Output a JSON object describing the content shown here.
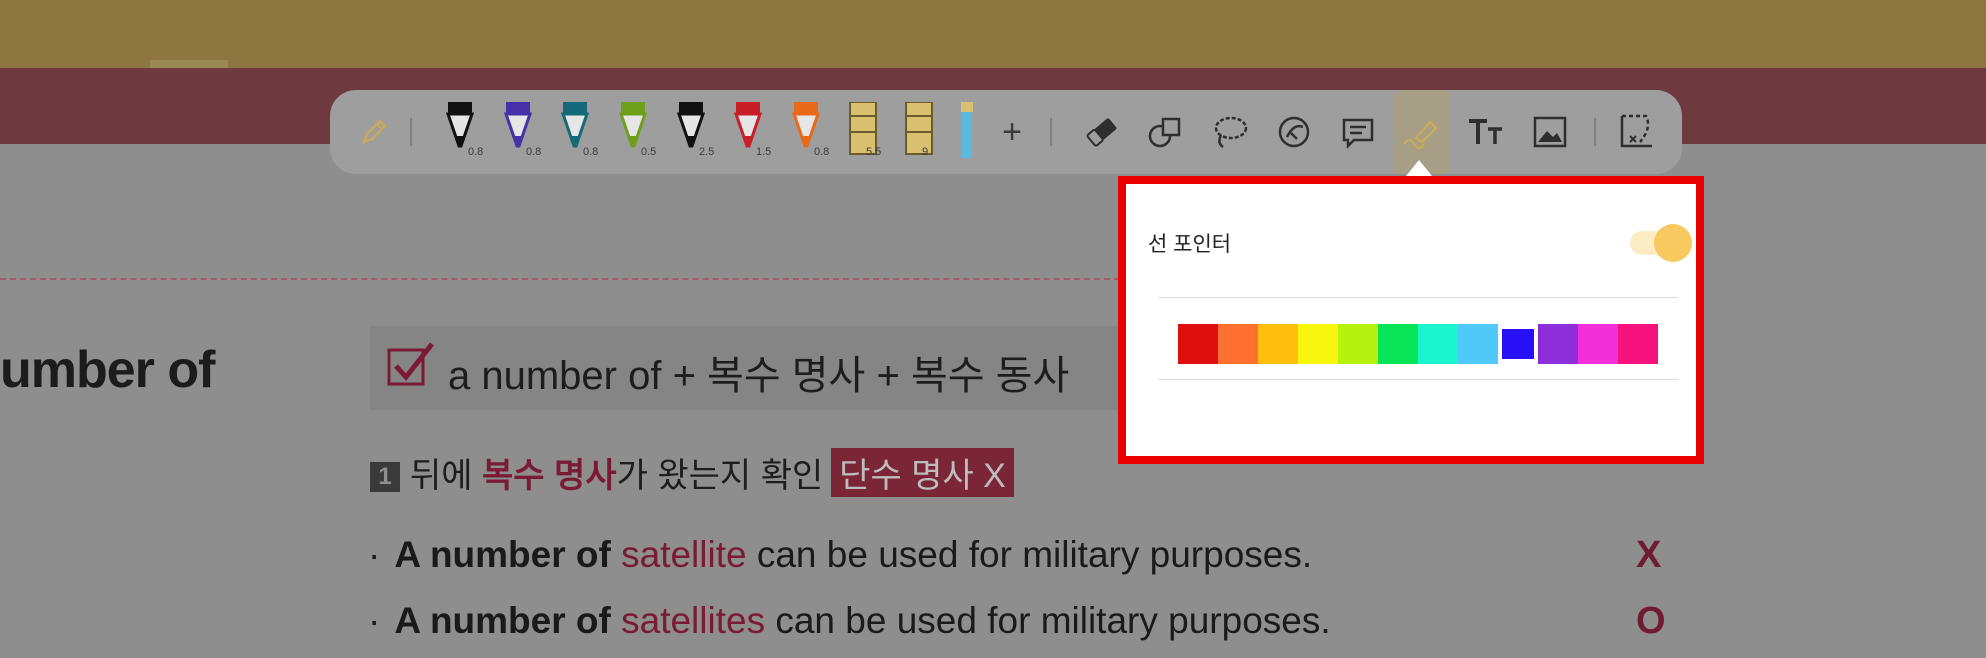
{
  "toolbar": {
    "pens": [
      {
        "color": "#111111",
        "size": "0.8"
      },
      {
        "color": "#4631a8",
        "size": "0.8"
      },
      {
        "color": "#146a78",
        "size": "0.8"
      },
      {
        "color": "#6ea01c",
        "size": "0.5"
      },
      {
        "color": "#111111",
        "size": "2.5"
      },
      {
        "color": "#c81e28",
        "size": "1.5"
      },
      {
        "color": "#e66a1a",
        "size": "0.8"
      }
    ],
    "tapes": [
      {
        "color": "#d9c070",
        "size": "5.5"
      },
      {
        "color": "#d9c070",
        "size": "9"
      }
    ],
    "add_label": "+",
    "tool_icons": [
      "eraser-icon",
      "shapes-icon",
      "lasso-icon",
      "sticker-icon",
      "comment-icon",
      "laser-pointer-icon",
      "text-icon",
      "image-icon",
      "crop-icon"
    ]
  },
  "popup": {
    "label": "선 포인터",
    "toggle_on": true,
    "colors": [
      "#e00f0f",
      "#ff6f2e",
      "#ffbe0b",
      "#f8f50e",
      "#b6f20e",
      "#08e558",
      "#1cf4cf",
      "#4fc8fa",
      "#2810f6",
      "#8d2ed9",
      "#f32fd9",
      "#f5127e"
    ],
    "selected_color_index": 8,
    "accent": "#ea0000"
  },
  "page": {
    "left_title": "umber of",
    "heading": "a number of + 복수 명사 + 복수 동사",
    "rule_number": "1",
    "rule_pre": "뒤에 ",
    "rule_highlight": "복수 명사",
    "rule_post": "가 왔는지 확인",
    "rule_tag": "단수 명사 X",
    "sentences": [
      {
        "bullet": "·",
        "bold": "A number of",
        "noun": "satellite",
        "rest": "can be used for military purposes.",
        "mark": "X"
      },
      {
        "bullet": "·",
        "bold": "A number of",
        "noun": "satellites",
        "rest": "can be used for military purposes.",
        "mark": "O"
      }
    ]
  }
}
